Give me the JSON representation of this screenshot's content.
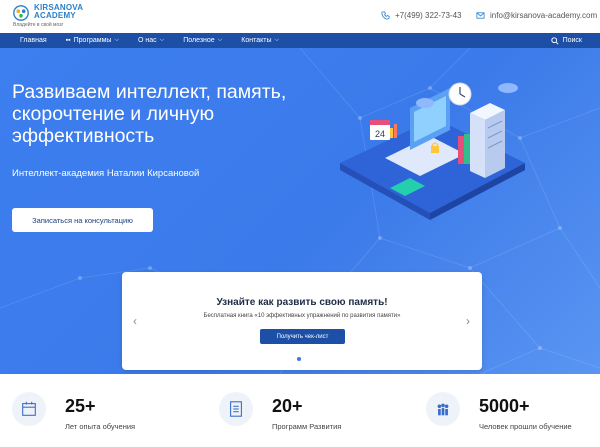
{
  "header": {
    "logo_line1": "KIRSANOVA",
    "logo_line2": "ACADEMY",
    "logo_tagline": "Владейте в свой мозг",
    "phone": "+7(499) 322-73-43",
    "email": "info@kirsanova-academy.com"
  },
  "nav": {
    "items": [
      {
        "label": "Главная"
      },
      {
        "label": "Программы"
      },
      {
        "label": "О нас"
      },
      {
        "label": "Полезное"
      },
      {
        "label": "Контакты"
      }
    ],
    "search_label": "Поиск"
  },
  "hero": {
    "title": "Развиваем интеллект, память, скорочтение и личную эффективность",
    "subtitle": "Интеллект-академия Наталии Кирсановой",
    "cta_label": "Записаться на консультацию",
    "calendar_day": "24"
  },
  "carousel": {
    "title": "Узнайте как развить свою память!",
    "text": "Бесплатная книга «10 эффективных упражнений по развития памяти»",
    "button_label": "Получить чек-лист",
    "prev": "‹",
    "next": "›"
  },
  "stats": [
    {
      "number": "25+",
      "label": "Лет опыта обучения",
      "icon": "calendar-icon"
    },
    {
      "number": "20+",
      "label": "Программ Развития",
      "icon": "document-icon"
    },
    {
      "number": "5000+",
      "label": "Человек прошли обучение",
      "icon": "people-icon"
    }
  ],
  "colors": {
    "nav_bg": "#1d4fa6",
    "hero_bg": "#3d7ef0",
    "accent": "#2a7fc9"
  }
}
